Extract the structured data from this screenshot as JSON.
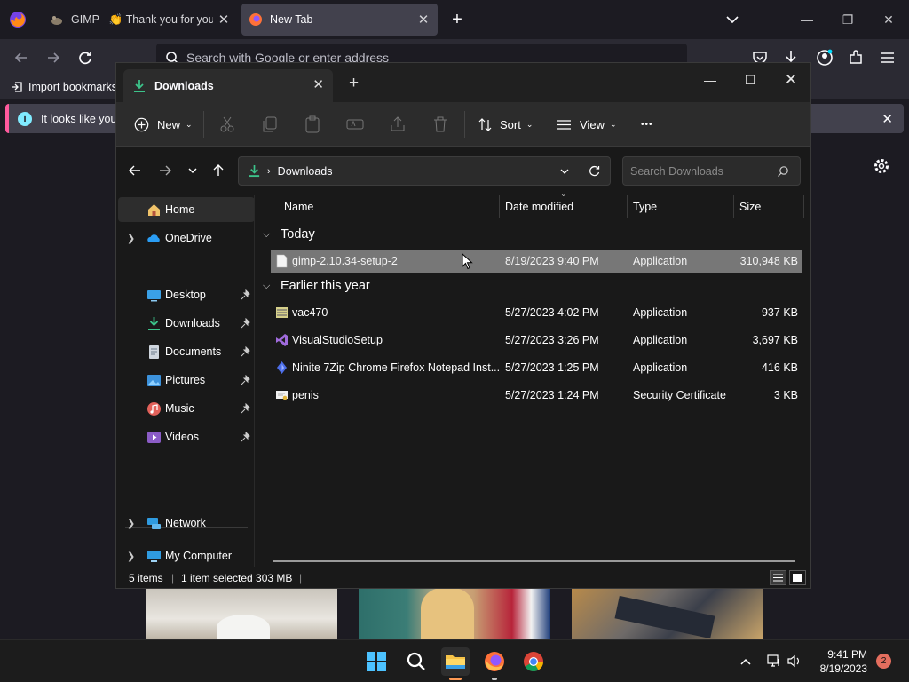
{
  "browser": {
    "tabs": [
      {
        "title": "GIMP - 👏 Thank you for your d"
      },
      {
        "title": "New Tab"
      }
    ],
    "urlbar_placeholder": "Search with Google or enter address",
    "bookmarks_import": "Import bookmarks...",
    "notification": "It looks like you"
  },
  "explorer": {
    "tab_title": "Downloads",
    "toolbar": {
      "new_label": "New",
      "sort_label": "Sort",
      "view_label": "View",
      "more_label": "•••"
    },
    "address": {
      "location": "Downloads"
    },
    "search_placeholder": "Search Downloads",
    "sidebar": {
      "home": "Home",
      "onedrive": "OneDrive",
      "desktop": "Desktop",
      "downloads": "Downloads",
      "documents": "Documents",
      "pictures": "Pictures",
      "music": "Music",
      "videos": "Videos",
      "mycomputer": "My Computer",
      "network": "Network"
    },
    "columns": {
      "name": "Name",
      "date": "Date modified",
      "type": "Type",
      "size": "Size"
    },
    "groups": {
      "today": "Today",
      "earlier": "Earlier this year"
    },
    "files": [
      {
        "name": "gimp-2.10.34-setup-2",
        "date": "8/19/2023 9:40 PM",
        "type": "Application",
        "size": "310,948 KB",
        "selected": true
      },
      {
        "name": "vac470",
        "date": "5/27/2023 4:02 PM",
        "type": "Application",
        "size": "937 KB",
        "selected": false
      },
      {
        "name": "VisualStudioSetup",
        "date": "5/27/2023 3:26 PM",
        "type": "Application",
        "size": "3,697 KB",
        "selected": false
      },
      {
        "name": "Ninite 7Zip Chrome Firefox Notepad Inst...",
        "date": "5/27/2023 1:25 PM",
        "type": "Application",
        "size": "416 KB",
        "selected": false
      },
      {
        "name": "penis",
        "date": "5/27/2023 1:24 PM",
        "type": "Security Certificate",
        "size": "3 KB",
        "selected": false
      }
    ],
    "status": {
      "items": "5 items",
      "selected": "1 item selected 303 MB"
    }
  },
  "taskbar": {
    "time": "9:41 PM",
    "date": "8/19/2023",
    "notification_count": "2"
  },
  "colors": {
    "selection": "#777777",
    "accent_firefox": "#ff5a9d",
    "explorer_bg": "#191919"
  }
}
